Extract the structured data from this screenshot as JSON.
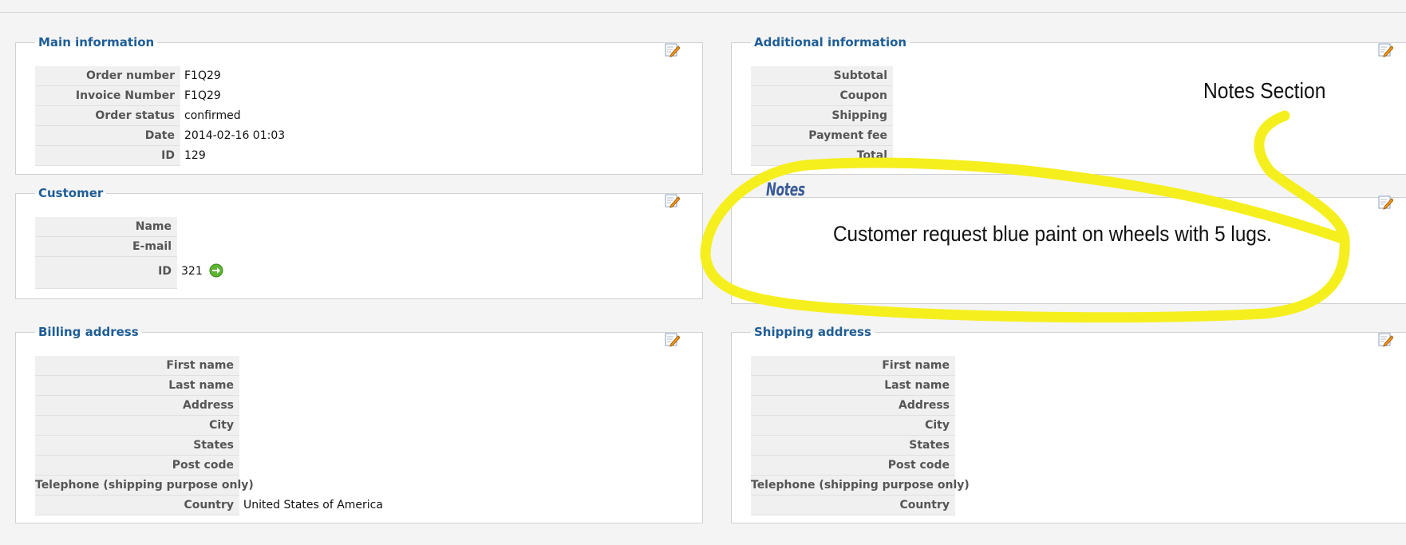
{
  "main_info": {
    "title": "Main information",
    "rows": [
      {
        "label": "Order number",
        "value": "F1Q29"
      },
      {
        "label": "Invoice Number",
        "value": "F1Q29"
      },
      {
        "label": "Order status",
        "value": "confirmed"
      },
      {
        "label": "Date",
        "value": "2014-02-16 01:03"
      },
      {
        "label": "ID",
        "value": "129"
      }
    ]
  },
  "additional_info": {
    "title": "Additional information",
    "rows": [
      {
        "label": "Subtotal",
        "value": ""
      },
      {
        "label": "Coupon",
        "value": ""
      },
      {
        "label": "Shipping",
        "value": ""
      },
      {
        "label": "Payment fee",
        "value": ""
      },
      {
        "label": "Total",
        "value": ""
      }
    ]
  },
  "customer": {
    "title": "Customer",
    "rows": [
      {
        "label": "Name",
        "value": ""
      },
      {
        "label": "E-mail",
        "value": ""
      },
      {
        "label": "ID",
        "value": "321"
      }
    ]
  },
  "notes": {
    "title": "Notes",
    "text": "Customer request blue paint on wheels with 5 lugs."
  },
  "annotation": {
    "label": "Notes Section",
    "highlight_color": "#f5ef1d"
  },
  "billing": {
    "title": "Billing address",
    "rows": [
      {
        "label": "First name",
        "value": ""
      },
      {
        "label": "Last name",
        "value": ""
      },
      {
        "label": "Address",
        "value": ""
      },
      {
        "label": "City",
        "value": ""
      },
      {
        "label": "States",
        "value": ""
      },
      {
        "label": "Post code",
        "value": ""
      },
      {
        "label": "Telephone (shipping purpose only)",
        "value": ""
      },
      {
        "label": "Country",
        "value": "United States of America"
      }
    ]
  },
  "shipping": {
    "title": "Shipping address",
    "rows": [
      {
        "label": "First name",
        "value": ""
      },
      {
        "label": "Last name",
        "value": ""
      },
      {
        "label": "Address",
        "value": ""
      },
      {
        "label": "City",
        "value": ""
      },
      {
        "label": "States",
        "value": ""
      },
      {
        "label": "Post code",
        "value": ""
      },
      {
        "label": "Telephone (shipping purpose only)",
        "value": ""
      },
      {
        "label": "Country",
        "value": ""
      }
    ]
  },
  "icons": {
    "edit": "edit-pencil-icon",
    "go": "green-arrow-icon"
  },
  "colors": {
    "legend": "#1f5e96",
    "label_bg": "#f0f0f0",
    "notes_title": "#3a5a9a"
  }
}
